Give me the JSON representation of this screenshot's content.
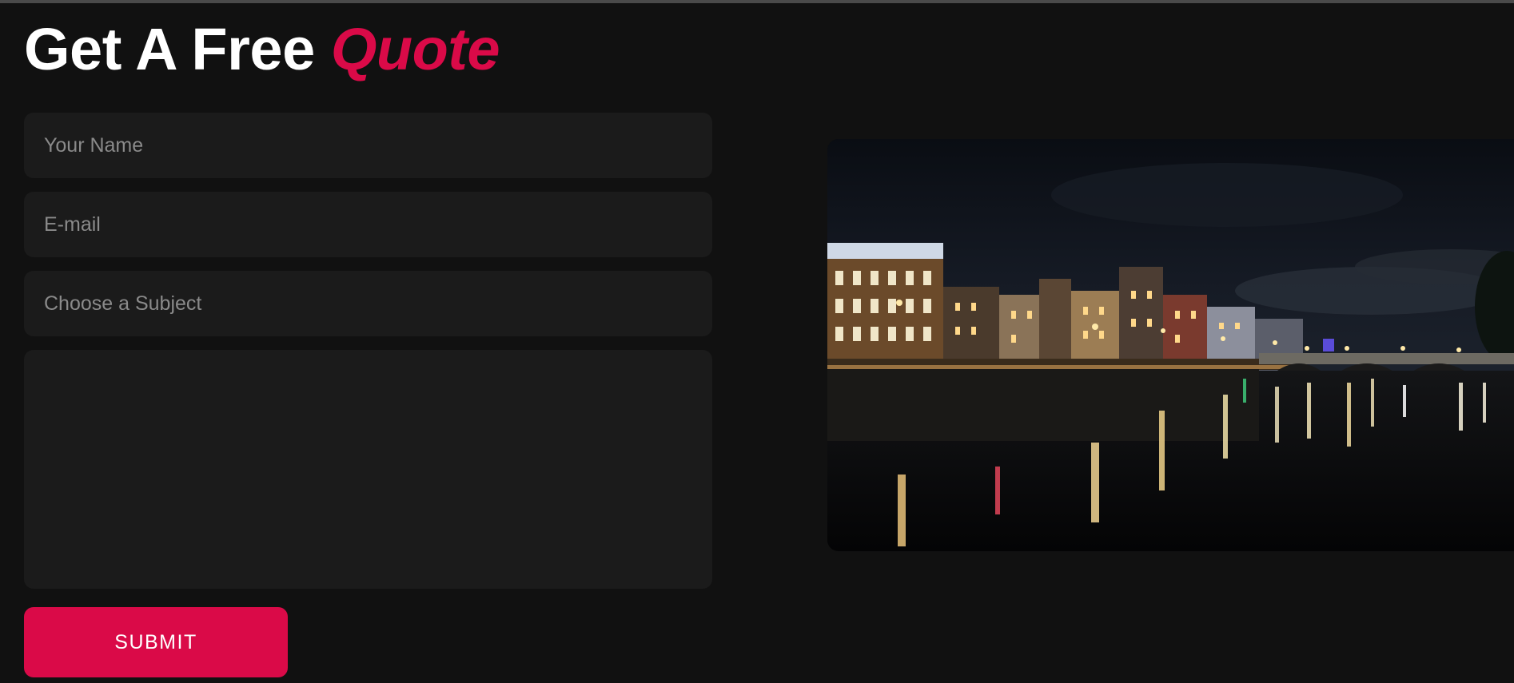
{
  "heading": {
    "part1": "Get A Free",
    "accent": "Quote"
  },
  "form": {
    "name_placeholder": "Your Name",
    "email_placeholder": "E-mail",
    "subject_placeholder": "Choose a Subject",
    "message_placeholder": "",
    "submit_label": "SUBMIT"
  },
  "colors": {
    "background": "#111111",
    "field_bg": "#1b1b1b",
    "accent": "#da0a48",
    "heading_text": "#ffffff",
    "placeholder_text": "#8a8a8a"
  },
  "photo": {
    "subject": "night-city-river-with-bridge-and-light-reflections"
  }
}
